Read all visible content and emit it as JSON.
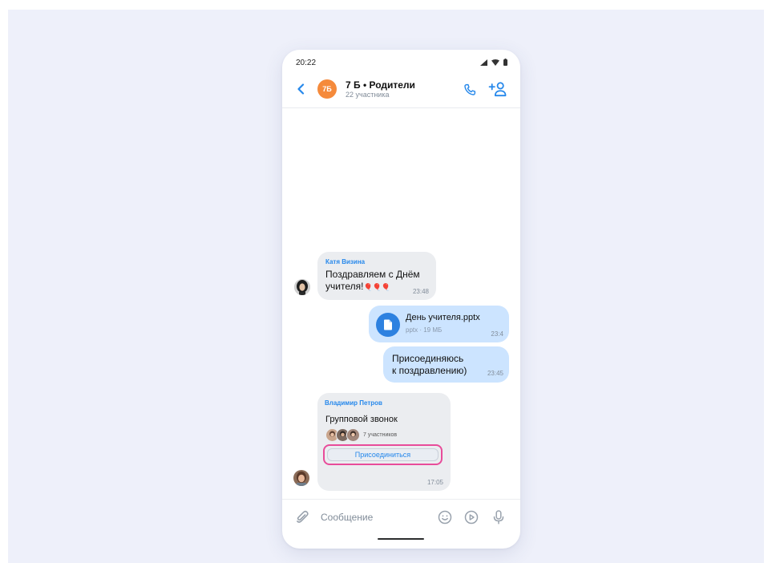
{
  "status_bar": {
    "time": "20:22"
  },
  "header": {
    "avatar_initials": "7Б",
    "title": "7 Б • Родители",
    "subtitle": "22 участника"
  },
  "messages": [
    {
      "type": "incoming",
      "sender": "Катя Визина",
      "text_line1": "Поздравляем с Днём",
      "text_line2": "учителя!",
      "emoji": "🎈🎈🎈",
      "time": "23:48"
    },
    {
      "type": "outgoing-file",
      "file_name": "День учителя.pptx",
      "file_meta": "pptx · 19 МБ",
      "time": "23:4"
    },
    {
      "type": "outgoing",
      "text_line1": "Присоединяюсь",
      "text_line2": "к поздравлению)",
      "time": "23:45"
    },
    {
      "type": "incoming-call",
      "sender": "Владимир Петров",
      "title": "Групповой звонок",
      "participants": "7 участников",
      "join_label": "Присоединиться",
      "time": "17:05"
    }
  ],
  "composer": {
    "placeholder": "Сообщение"
  },
  "colors": {
    "accent": "#2688eb",
    "highlight": "#e84c9a",
    "avatar": "#f58a3b",
    "outgoing_bubble": "#cce4ff",
    "incoming_bubble": "#ebedf0"
  }
}
